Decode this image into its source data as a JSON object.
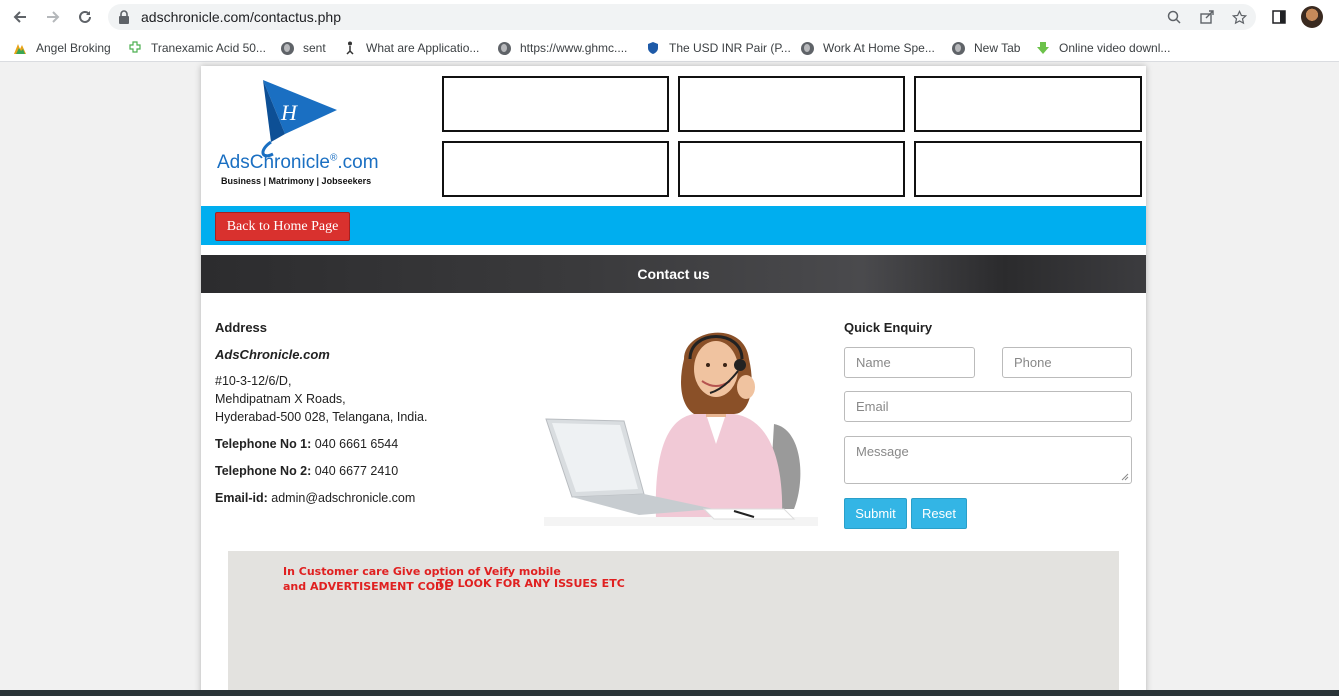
{
  "browser": {
    "url": "adschronicle.com/contactus.php",
    "bookmarks": [
      {
        "label": "Angel Broking",
        "icon": "angel-icon"
      },
      {
        "label": "Tranexamic Acid 50...",
        "icon": "puzzle-icon"
      },
      {
        "label": "sent",
        "icon": "globe-icon"
      },
      {
        "label": "What are Applicatio...",
        "icon": "figure-icon"
      },
      {
        "label": "https://www.ghmc....",
        "icon": "globe-icon"
      },
      {
        "label": "The USD INR Pair (P...",
        "icon": "shield-icon"
      },
      {
        "label": "Work At Home Spe...",
        "icon": "globe-icon"
      },
      {
        "label": "New Tab",
        "icon": "globe-icon"
      },
      {
        "label": "Online video downl...",
        "icon": "download-icon"
      }
    ]
  },
  "header": {
    "logo_text": "AdsChronicle",
    "logo_reg": "®",
    "logo_suffix": ".com",
    "logo_tagline": "Business | Matrimony | Jobseekers"
  },
  "nav": {
    "home_button": "Back to Home Page"
  },
  "section_title": "Contact us",
  "address": {
    "heading": "Address",
    "company": "AdsChronicle.com",
    "line1": "#10-3-12/6/D,",
    "line2": "Mehdipatnam X Roads,",
    "line3": "Hyderabad-500 028, Telangana, India.",
    "tel1_label": "Telephone No 1:",
    "tel1_value": "040 6661 6544",
    "tel2_label": "Telephone No 2:",
    "tel2_value": "040 6677 2410",
    "email_label": "Email-id:",
    "email_value": "admin@adschronicle.com"
  },
  "enquiry": {
    "title": "Quick Enquiry",
    "name_placeholder": "Name",
    "phone_placeholder": "Phone",
    "email_placeholder": "Email",
    "message_placeholder": "Message",
    "submit_label": "Submit",
    "reset_label": "Reset"
  },
  "annotation": {
    "line1": "In Customer care Give option of Veify mobile",
    "line2": "and ADVERTISEMENT CODE",
    "line3": "TO LOOK FOR ANY ISSUES ETC"
  },
  "colors": {
    "accent_blue": "#00aeef",
    "home_button_red": "#d9312e",
    "button_cyan": "#33b5e5",
    "note_red": "#e02020"
  }
}
